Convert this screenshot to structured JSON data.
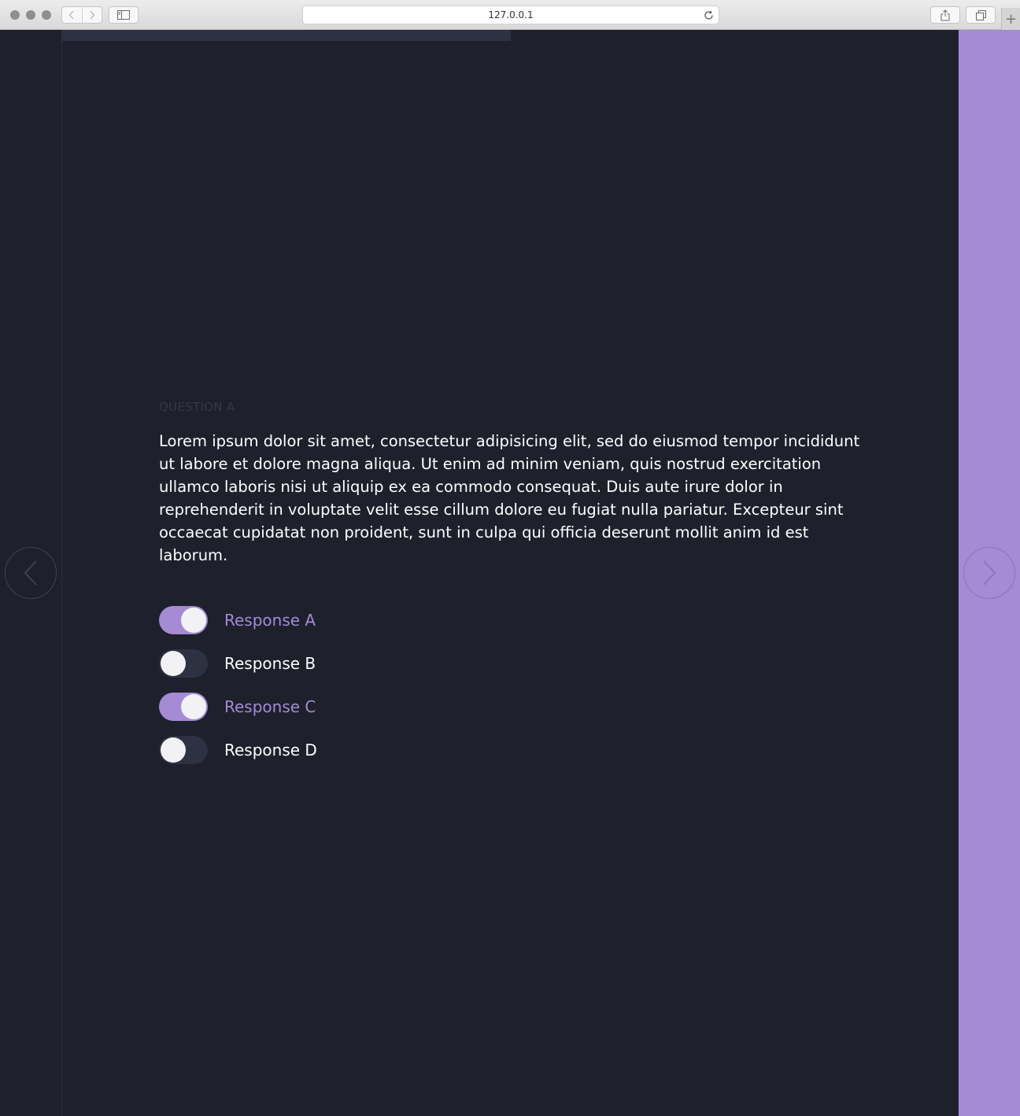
{
  "browser": {
    "url": "127.0.0.1",
    "new_tab_label": "+"
  },
  "progress": {
    "fraction": 0.5
  },
  "question": {
    "label": "QUESTION A",
    "text": "Lorem ipsum dolor sit amet, consectetur adipisicing elit, sed do eiusmod tempor incididunt ut labore et dolore magna aliqua. Ut enim ad minim veniam, quis nostrud exercitation ullamco laboris nisi ut aliquip ex ea commodo consequat. Duis aute irure dolor in reprehenderit in voluptate velit esse cillum dolore eu fugiat nulla pariatur. Excepteur sint occaecat cupidatat non proident, sunt in culpa qui officia deserunt mollit anim id est laborum."
  },
  "responses": [
    {
      "label": "Response A",
      "selected": true
    },
    {
      "label": "Response B",
      "selected": false
    },
    {
      "label": "Response C",
      "selected": true
    },
    {
      "label": "Response D",
      "selected": false
    }
  ],
  "colors": {
    "background": "#1e202c",
    "accent": "#a48bd4",
    "toggle_off": "#2e3142",
    "text": "#ffffff",
    "muted_label": "#343748"
  },
  "icons": {
    "prev": "chevron-left-icon",
    "next": "chevron-right-icon"
  }
}
